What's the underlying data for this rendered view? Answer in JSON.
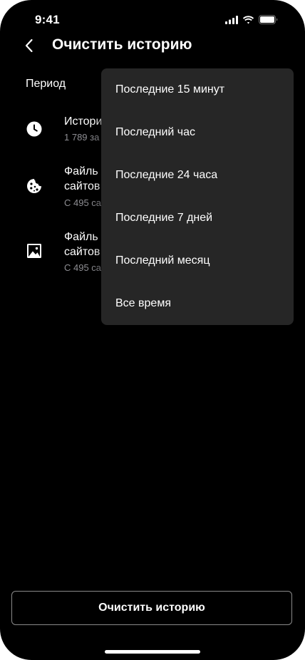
{
  "status_bar": {
    "time": "9:41"
  },
  "header": {
    "title": "Очистить историю"
  },
  "period": {
    "label": "Период",
    "options": [
      "Последние 15 минут",
      "Последний час",
      "Последние 24 часа",
      "Последние 7 дней",
      "Последний месяц",
      "Все время"
    ]
  },
  "items": [
    {
      "icon": "clock-icon",
      "title_lines": [
        "Истори"
      ],
      "subtitle": "1 789 за"
    },
    {
      "icon": "cookie-icon",
      "title_lines": [
        "Файль",
        "сайтов"
      ],
      "subtitle": "С 495 са"
    },
    {
      "icon": "image-icon",
      "title_lines": [
        "Файль",
        "сайтов"
      ],
      "subtitle": "С 495 са"
    }
  ],
  "footer": {
    "clear_button_label": "Очистить историю"
  },
  "colors": {
    "background": "#000000",
    "menu_background": "#262626",
    "secondary_text": "#8e8e93",
    "button_border": "#8a8a8a"
  }
}
